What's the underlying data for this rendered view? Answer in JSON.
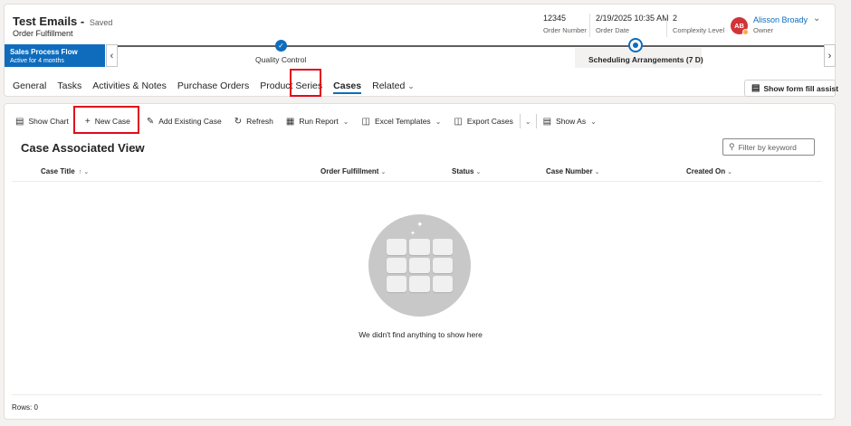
{
  "record": {
    "title": "Test Emails",
    "title_separator": "-",
    "status": "Saved",
    "entity": "Order Fulfillment"
  },
  "header_fields": [
    {
      "value": "12345",
      "label": "Order Number"
    },
    {
      "value": "2/19/2025 10:35 AM",
      "label": "Order Date"
    },
    {
      "value": "2",
      "label": "Complexity Level"
    }
  ],
  "owner": {
    "initials": "AB",
    "name": "Alisson Broady",
    "label": "Owner",
    "avatar_color": "#d13438"
  },
  "process": {
    "name": "Sales Process Flow",
    "active_for": "Active for 4 months",
    "stages": [
      {
        "name": "Quality Control",
        "state": "completed"
      },
      {
        "name": "Scheduling Arrangements",
        "duration": "(7 D)",
        "state": "active"
      }
    ]
  },
  "tabs": [
    "General",
    "Tasks",
    "Activities & Notes",
    "Purchase Orders",
    "Product Series",
    "Cases",
    "Related"
  ],
  "selected_tab": "Cases",
  "form_fill_assist": "Show form fill assist",
  "commands": {
    "show_chart": "Show Chart",
    "new_case": "New Case",
    "add_existing": "Add Existing Case",
    "refresh": "Refresh",
    "run_report": "Run Report",
    "excel_templates": "Excel Templates",
    "export_cases": "Export Cases",
    "show_as": "Show As"
  },
  "view": {
    "title": "Case Associated View",
    "filter_placeholder": "Filter by keyword",
    "columns": [
      "Case Title",
      "Order Fulfillment",
      "Status",
      "Case Number",
      "Created On"
    ],
    "empty_message": "We didn't find anything to show here",
    "rows_label": "Rows: 0"
  },
  "colors": {
    "accent": "#0f6cbd",
    "highlight": "#e00b1c"
  }
}
